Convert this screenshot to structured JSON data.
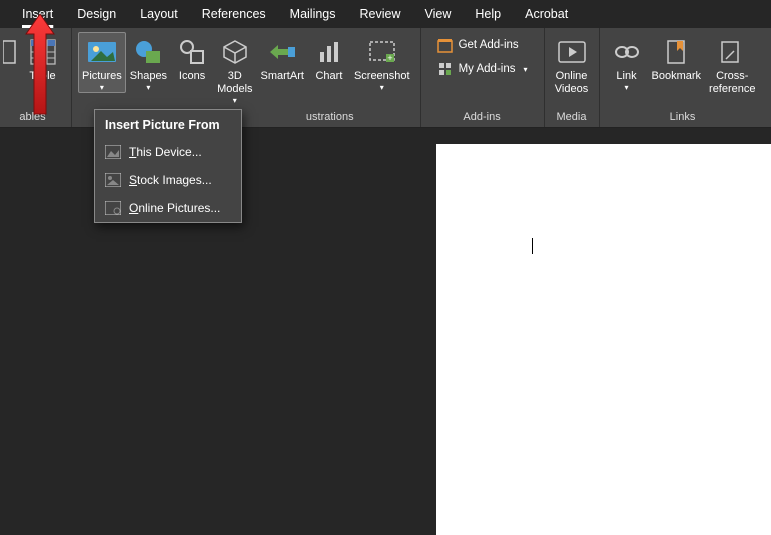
{
  "tabs": {
    "insert": "Insert",
    "design": "Design",
    "layout": "Layout",
    "references": "References",
    "mailings": "Mailings",
    "review": "Review",
    "view": "View",
    "help": "Help",
    "acrobat": "Acrobat"
  },
  "ribbon": {
    "table": "Table",
    "pictures": "Pictures",
    "shapes": "Shapes",
    "icons": "Icons",
    "models": "3D\nModels",
    "smartart": "SmartArt",
    "chart": "Chart",
    "screenshot": "Screenshot",
    "get_addins": "Get Add-ins",
    "my_addins": "My Add-ins",
    "online_videos": "Online\nVideos",
    "link": "Link",
    "bookmark": "Bookmark",
    "crossref": "Cross-\nreference",
    "groups": {
      "tables": "ables",
      "illustrations": "ustrations",
      "addins": "Add-ins",
      "media": "Media",
      "links": "Links"
    }
  },
  "popup": {
    "header": "Insert Picture From",
    "this_device": "This Device...",
    "stock_images": "Stock Images...",
    "online_pictures": "Online Pictures..."
  },
  "colors": {
    "accent_green": "#6aa84f",
    "accent_blue": "#4a9fd8",
    "accent_orange": "#e69138",
    "arrow_red": "#d92b2b"
  }
}
